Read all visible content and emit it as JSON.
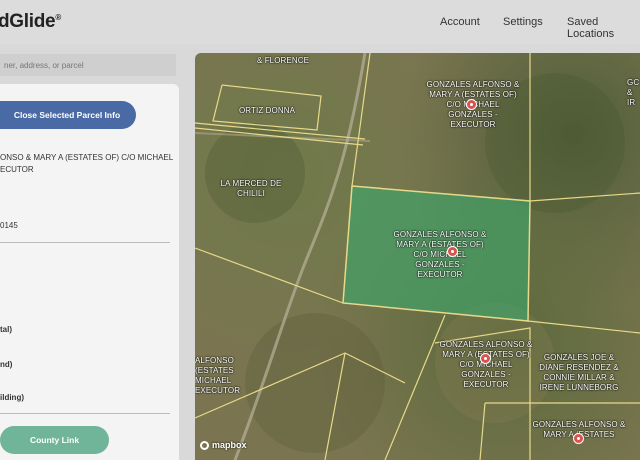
{
  "header": {
    "logo": "dGlide",
    "logo_mark": "®",
    "nav": {
      "account": "Account",
      "settings": "Settings",
      "saved": "Saved Locations"
    }
  },
  "search": {
    "placeholder": "ner, address, or parcel"
  },
  "panel": {
    "close_button": "Close Selected Parcel Info",
    "owner": "ONSO & MARY A (ESTATES OF) C/O MICHAEL ECUTOR",
    "parcel_id": "0145",
    "labels": {
      "total": "tal)",
      "land": "nd)",
      "building": "ilding)"
    },
    "county_link": "County Link"
  },
  "map": {
    "labels": {
      "florence": "& FLORENCE",
      "ortiz": "ORTIZ DONNA",
      "merced": "LA MERCED DE CHILILI",
      "gonzales_top": "GONZALES ALFONSO & MARY A (ESTATES OF) C/O MICHAEL GONZALES - EXECUTOR",
      "gonzales_center": "GONZALES ALFONSO & MARY A (ESTATES OF) C/O MICHAEL GONZALES - EXECUTOR",
      "gonzales_bottom": "GONZALES ALFONSO & MARY A (ESTATES OF) C/O MICHAEL GONZALES - EXECUTOR",
      "gonzales_left": "ALFONSO (ESTATES MICHAEL EXECUTOR",
      "gonzales_joe": "GONZALES JOE & DIANE RESENDEZ & CONNIE MILLAR & IRENE LUNNEBORG",
      "gonzales_br": "GONZALES ALFONSO & MARY A (ESTATES",
      "right_edge": "GC & IR"
    },
    "attribution": "mapbox",
    "colors": {
      "selected_fill": "#3fa56a",
      "boundary": "#e8d98a",
      "pin": "#d9534f"
    }
  }
}
